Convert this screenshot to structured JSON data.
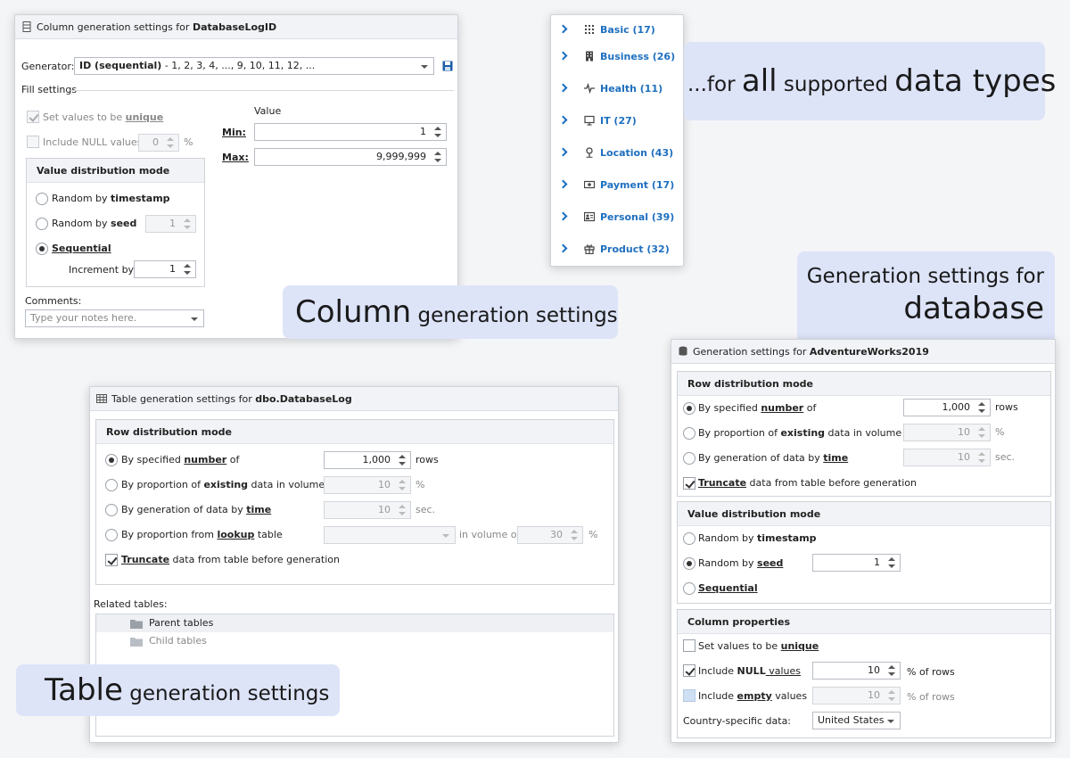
{
  "column_panel": {
    "title_prefix": "Column generation settings for ",
    "title_name": "DatabaseLogID",
    "generator_label": "Generator:",
    "generator_value_bold": "ID (sequential)",
    "generator_value_rest": " - 1, 2, 3, 4, ..., 9, 10, 11, 12, ...",
    "fill_settings_label": "Fill settings",
    "unique_prefix": "Set values to be ",
    "unique_key": "unique",
    "include_null_label": "Include NULL values",
    "null_pct": "0",
    "pct": "%",
    "value_header": "Value",
    "min_label": "Min:",
    "min_value": "1",
    "max_label": "Max:",
    "max_value": "9,999,999",
    "vdm_title": "Value distribution mode",
    "rand_ts_prefix": "Random by ",
    "rand_ts_key": "timestamp",
    "rand_seed_prefix": "Random by ",
    "rand_seed_key": "seed",
    "seed_value": "1",
    "sequential_label": "Sequential",
    "increment_label": "Increment by:",
    "increment_value": "1",
    "comments_label": "Comments:",
    "comments_placeholder": "Type your notes here."
  },
  "categories_panel": {
    "items": [
      {
        "label": "Basic (17)",
        "icon": "grid-icon"
      },
      {
        "label": "Business (26)",
        "icon": "building-icon"
      },
      {
        "label": "Health (11)",
        "icon": "heartbeat-icon"
      },
      {
        "label": "IT (27)",
        "icon": "monitor-icon"
      },
      {
        "label": "Location (43)",
        "icon": "pin-icon"
      },
      {
        "label": "Payment (17)",
        "icon": "money-icon"
      },
      {
        "label": "Personal (39)",
        "icon": "id-card-icon"
      },
      {
        "label": "Product (32)",
        "icon": "gift-icon"
      }
    ]
  },
  "callouts": {
    "types_pre": "...for ",
    "types_all": "all",
    "types_mid": " supported ",
    "types_dt": "data types",
    "column_big": "Column",
    "column_small": " generation settings",
    "db_line1": "Generation settings for",
    "db_line2": "database",
    "table_big": "Table",
    "table_small": " generation settings"
  },
  "table_panel": {
    "title_prefix": "Table generation settings for ",
    "title_name": "dbo.DatabaseLog",
    "rdm_title": "Row distribution mode",
    "by_number_prefix": "By specified ",
    "by_number_key": "number",
    "by_number_suffix": " of",
    "rows_value": "1,000",
    "rows_unit": "rows",
    "by_prop_prefix": "By proportion of ",
    "by_prop_key": "existing",
    "by_prop_suffix": " data in volume of",
    "prop_value": "10",
    "pct": "%",
    "by_time_prefix": "By generation of data by ",
    "by_time_key": "time",
    "time_value": "10",
    "sec": "sec.",
    "by_lookup_prefix": "By proportion from ",
    "by_lookup_key": "lookup",
    "by_lookup_suffix": " table",
    "in_volume_label": "in volume of",
    "lookup_value": "30",
    "truncate_key": "Truncate",
    "truncate_suffix": " data from table before generation",
    "related_label": "Related tables:",
    "parent_tables": "Parent tables",
    "child_tables": "Child tables"
  },
  "db_panel": {
    "title_prefix": "Generation settings for ",
    "title_name": "AdventureWorks2019",
    "rdm_title": "Row distribution mode",
    "by_number_prefix": "By specified ",
    "by_number_key": "number",
    "by_number_suffix": " of",
    "rows_value": "1,000",
    "rows_unit": "rows",
    "by_prop_prefix": "By proportion of ",
    "by_prop_key": "existing",
    "by_prop_suffix": " data in volume of",
    "prop_value": "10",
    "pct": "%",
    "by_time_prefix": "By generation of data by ",
    "by_time_key": "time",
    "time_value": "10",
    "sec": "sec.",
    "truncate_key": "Truncate",
    "truncate_suffix": " data from table before generation",
    "vdm_title": "Value distribution mode",
    "rand_ts_prefix": "Random by ",
    "rand_ts_key": "timestamp",
    "rand_seed_prefix": "Random by ",
    "rand_seed_key": "seed",
    "seed_value": "1",
    "sequential_label": "Sequential",
    "colprops_title": "Column properties",
    "unique_prefix": "Set values to be ",
    "unique_key": "unique",
    "null_prefix": "Include ",
    "null_key": "NULL",
    "null_suffix": " values",
    "null_value": "10",
    "pct_rows": "% of rows",
    "empty_prefix": "Include ",
    "empty_key": "empty",
    "empty_suffix": " values",
    "empty_value": "10",
    "country_label": "Country-specific data:",
    "country_value": "United States"
  }
}
